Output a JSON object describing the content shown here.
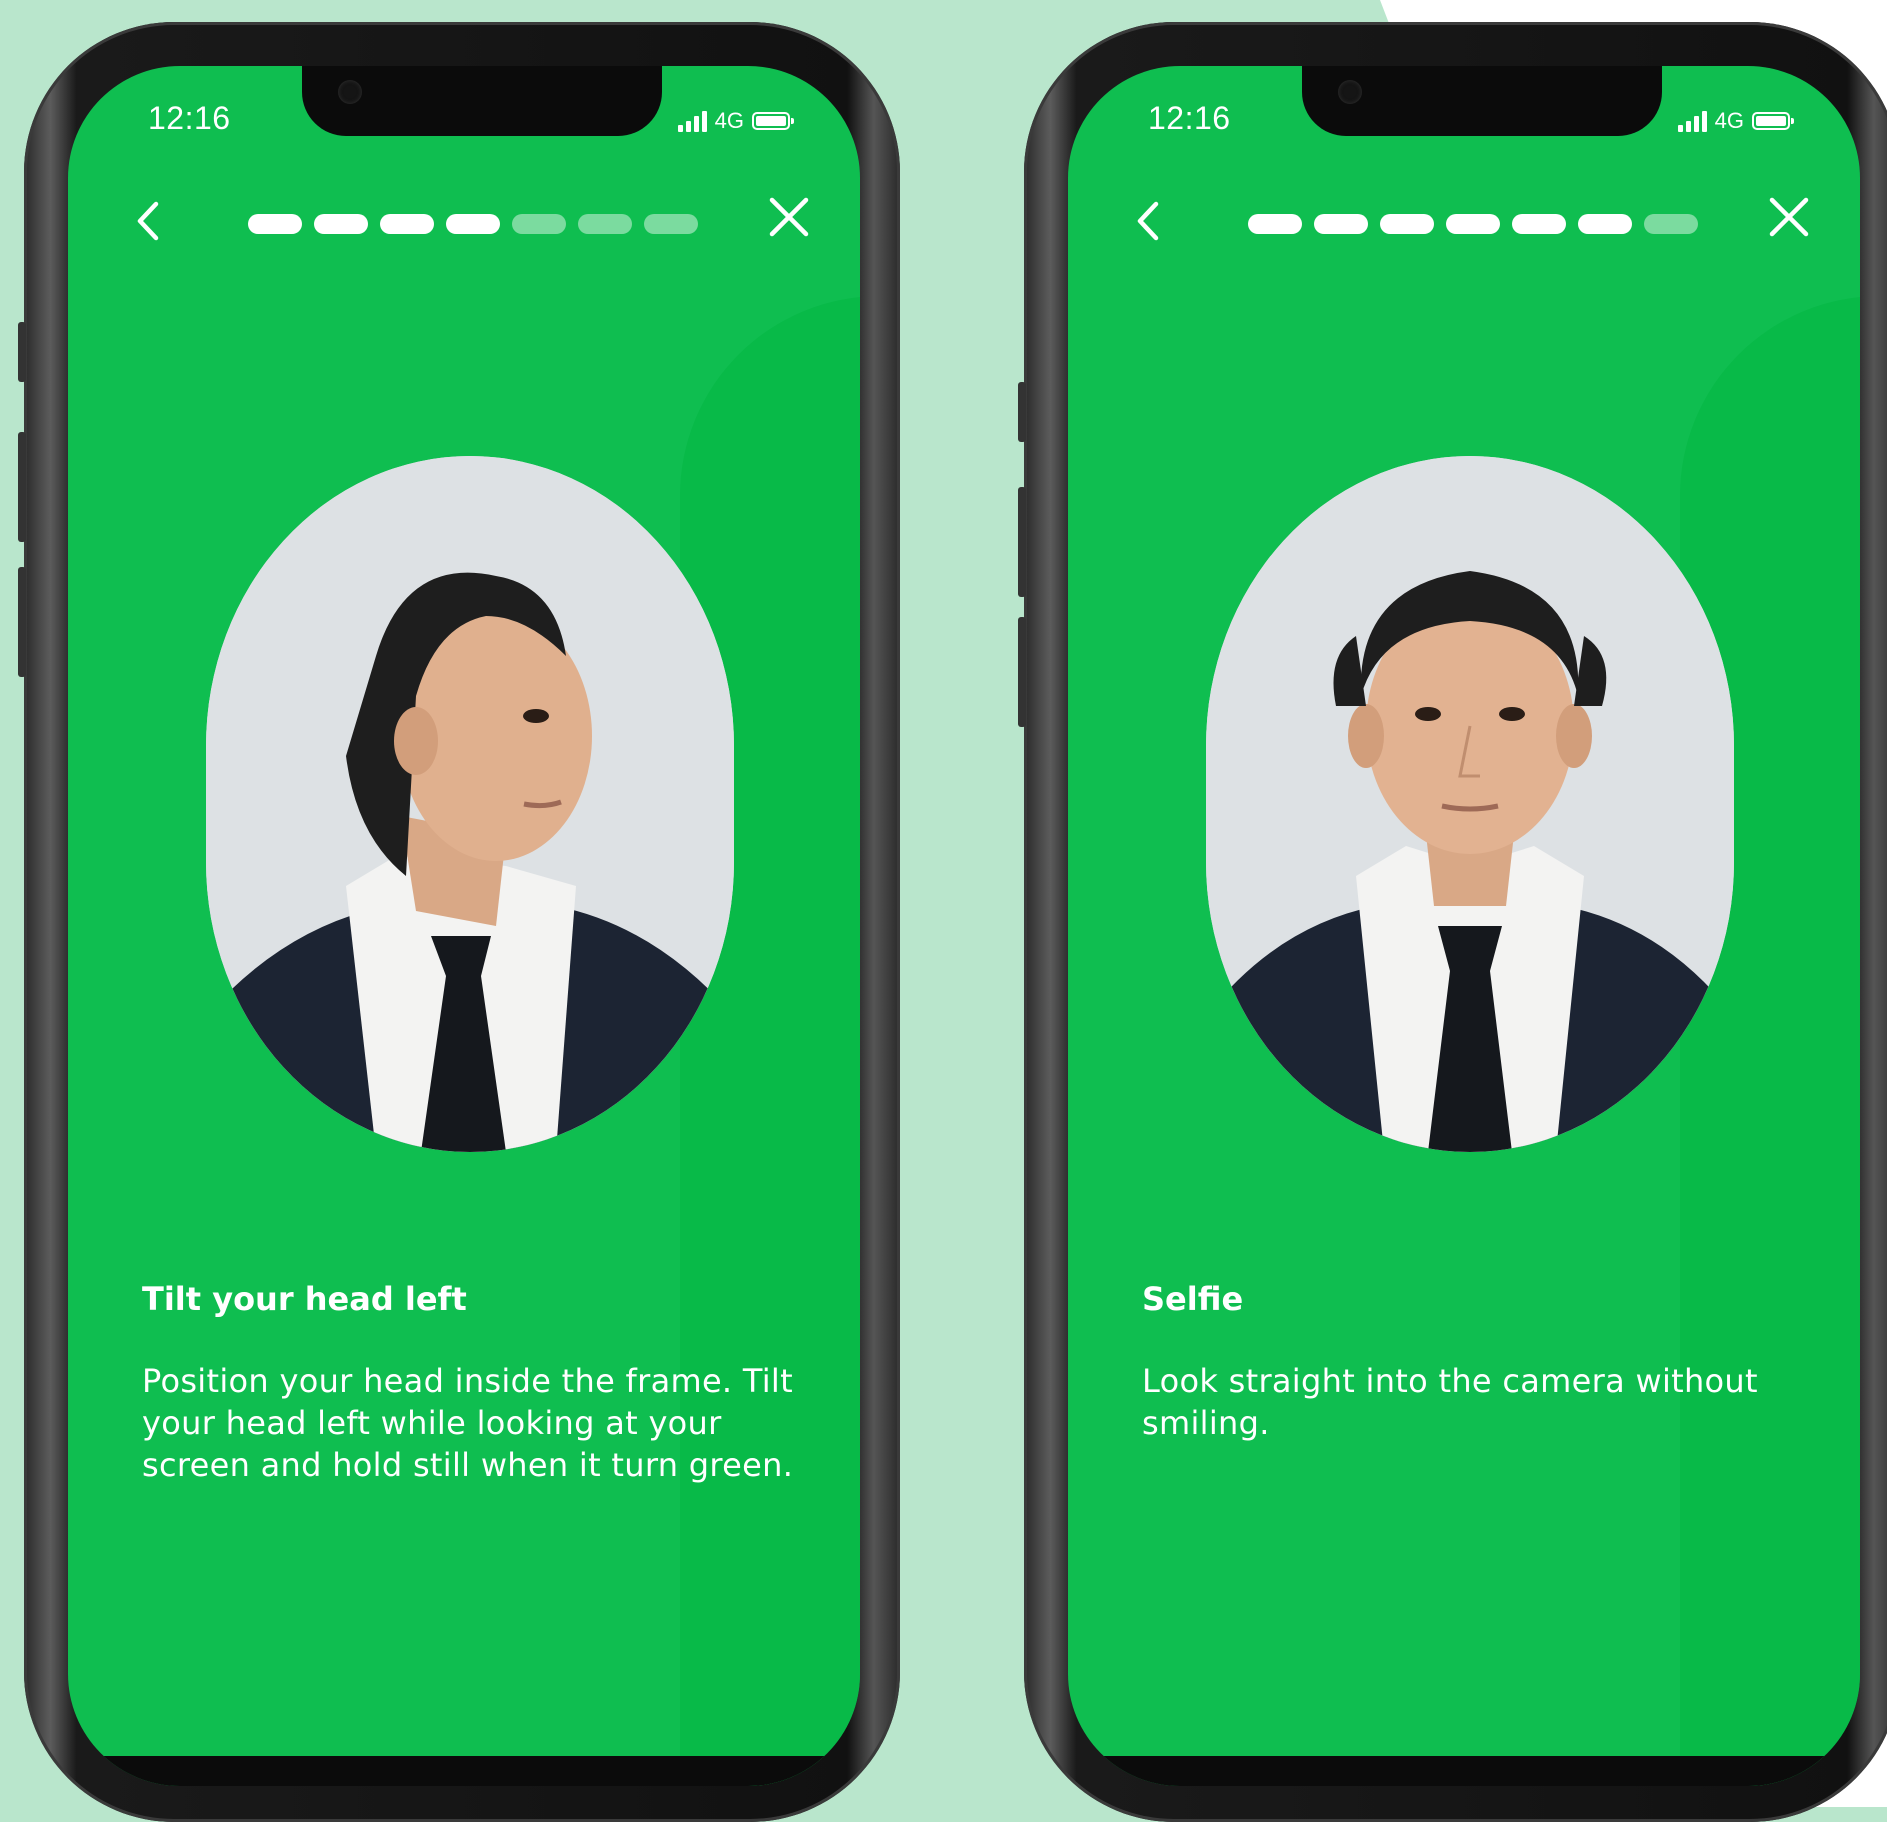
{
  "colors": {
    "page_background": "#b9e6cc",
    "screen_green": "#0fbe50",
    "progress_inactive": "rgba(255,255,255,0.45)",
    "text": "#ffffff"
  },
  "screens": [
    {
      "status": {
        "time": "12:16",
        "network": "4G"
      },
      "progress": {
        "total_steps": 7,
        "completed_steps": 4
      },
      "icons": {
        "back": "chevron-left-icon",
        "close": "close-icon"
      },
      "photo": {
        "pose": "head turned left"
      },
      "title": "Tilt your head left",
      "body": "Position your head inside the frame. Tilt your head left while looking at your screen and hold still when it turn green."
    },
    {
      "status": {
        "time": "12:16",
        "network": "4G"
      },
      "progress": {
        "total_steps": 7,
        "completed_steps": 6
      },
      "icons": {
        "back": "chevron-left-icon",
        "close": "close-icon"
      },
      "photo": {
        "pose": "facing camera"
      },
      "title": "Selfie",
      "body": "Look straight into the camera without smiling."
    }
  ]
}
